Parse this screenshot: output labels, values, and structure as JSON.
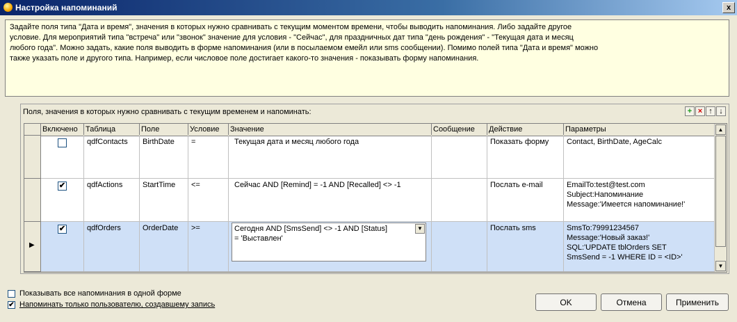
{
  "window": {
    "title": "Настройка напоминаний",
    "close_glyph": "x"
  },
  "info": {
    "lines": [
      "Задайте поля типа \"Дата и время\", значения в которых нужно сравнивать с текущим моментом времени, чтобы выводить напоминания. Либо задайте другое",
      "условие. Для мероприятий типа \"встреча\" или \"звонок\" значение для условия - \"Сейчас\", для праздничных дат типа \"день рождения\" - \"Текущая дата и месяц",
      "любого года\". Можно задать, какие поля выводить в форме напоминания (или в посылаемом емейл или sms сообщении). Помимо полей типа \"Дата и время\" можно",
      "также указать поле и другого типа. Например, если числовое поле достигает какого-то значения - показывать форму напоминания."
    ]
  },
  "grid": {
    "caption": "Поля, значения в которых нужно сравнивать с текущим временем и напоминать:",
    "toolbar": {
      "add": "+",
      "delete": "×",
      "up": "↑",
      "down": "↓"
    },
    "headers": [
      "Включено",
      "Таблица",
      "Поле",
      "Условие",
      "Значение",
      "Сообщение",
      "Действие",
      "Параметры"
    ],
    "rows": [
      {
        "enabled": false,
        "table": "qdfContacts",
        "field": "BirthDate",
        "condition": "=",
        "value": "Текущая дата и месяц любого года",
        "message": "",
        "action": "Показать форму",
        "params": "Contact, BirthDate, AgeCalc"
      },
      {
        "enabled": true,
        "table": "qdfActions",
        "field": "StartTime",
        "condition": "<=",
        "value": "Сейчас AND [Remind] = -1 AND [Recalled] <> -1",
        "message": "",
        "action": "Послать e-mail",
        "params": "EmailTo:test@test.com\nSubject:Напоминание\nMessage:'Имеется напоминание!'"
      },
      {
        "enabled": true,
        "table": "qdfOrders",
        "field": "OrderDate",
        "condition": ">=",
        "value": "Сегодня AND [SmsSend] <> -1 AND [Status]\n= 'Выставлен'",
        "message": "",
        "action": "Послать sms",
        "params": "SmsTo:79991234567\nMessage:'Новый заказ!'\nSQL:'UPDATE tblOrders SET\nSmsSend = -1 WHERE ID = <ID>'"
      }
    ]
  },
  "options": {
    "show_all_in_one": {
      "label": "Показывать все напоминания в одной форме",
      "checked": false
    },
    "only_creator": {
      "label": "Напоминать только пользователю, создавшему запись",
      "checked": true
    }
  },
  "buttons": {
    "ok": "OK",
    "cancel": "Отмена",
    "apply": "Применить"
  }
}
